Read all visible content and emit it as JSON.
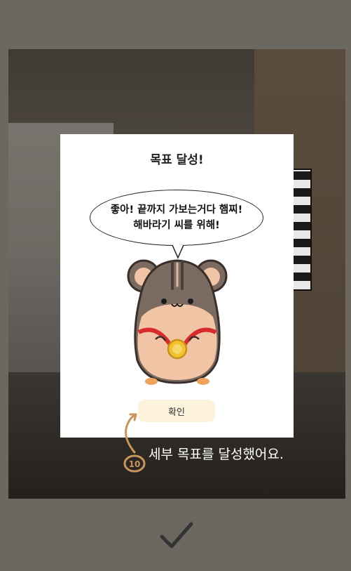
{
  "modal": {
    "title": "목표 달성!",
    "speech_line1": "좋아! 끝까지 가보는거다 햄찌!",
    "speech_line2": "해바라기 씨를 위해!",
    "confirm_label": "확인"
  },
  "annotation": {
    "step_number": "10",
    "caption": "세부 목표를 달성했어요."
  },
  "icons": {
    "confirm": "checkmark-icon",
    "character": "hamster-medal-illustration"
  },
  "colors": {
    "overlay": "#6b6860",
    "modal_bg": "#ffffff",
    "confirm_bg": "#fdf3dd",
    "annotation": "#c8955a",
    "checkmark": "#333333"
  }
}
